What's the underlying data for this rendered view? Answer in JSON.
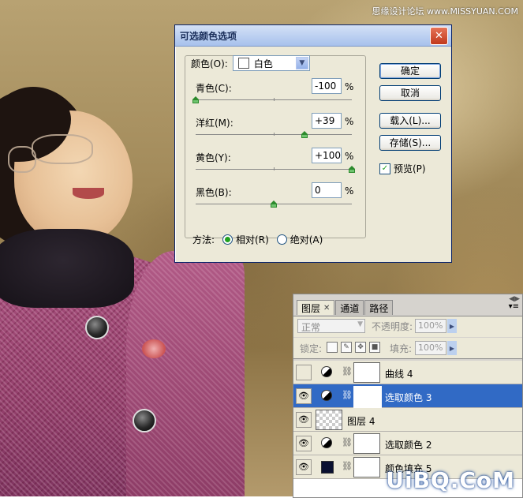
{
  "watermark_top": "思缘设计论坛 www.MISSYUAN.COM",
  "watermark_bottom": "UiBQ.CoM",
  "dialog": {
    "title": "可选颜色选项",
    "close_glyph": "✕",
    "colors_label": "颜色(O):",
    "colors_value": "白色",
    "sliders": [
      {
        "label": "青色(C):",
        "value": "-100",
        "unit": "%",
        "level": -100
      },
      {
        "label": "洋红(M):",
        "value": "+39",
        "unit": "%",
        "level": 39
      },
      {
        "label": "黄色(Y):",
        "value": "+100",
        "unit": "%",
        "level": 100
      },
      {
        "label": "黑色(B):",
        "value": "0",
        "unit": "%",
        "level": 0
      }
    ],
    "method_label": "方法:",
    "method_relative": "相对(R)",
    "method_absolute": "绝对(A)",
    "method_selected": "relative",
    "buttons": {
      "ok": "确定",
      "cancel": "取消",
      "load": "载入(L)...",
      "save": "存储(S)..."
    },
    "preview_label": "预览(P)",
    "preview_checked": true
  },
  "layers_panel": {
    "tabs": [
      {
        "label": "图层",
        "active": true,
        "closable": true
      },
      {
        "label": "通道",
        "active": false,
        "closable": false
      },
      {
        "label": "路径",
        "active": false,
        "closable": false
      }
    ],
    "blend_mode": "正常",
    "opacity_label": "不透明度:",
    "opacity_value": "100%",
    "lock_label": "锁定:",
    "fill_label": "填充:",
    "fill_value": "100%",
    "layers": [
      {
        "name": "曲线 4",
        "visible": false,
        "type": "adjustment",
        "selected": false
      },
      {
        "name": "选取颜色 3",
        "visible": true,
        "type": "adjustment",
        "selected": true
      },
      {
        "name": "图层 4",
        "visible": true,
        "type": "pixel",
        "selected": false
      },
      {
        "name": "选取颜色 2",
        "visible": true,
        "type": "adjustment",
        "selected": false
      },
      {
        "name": "颜色填充 5",
        "visible": true,
        "type": "fill",
        "selected": false
      }
    ]
  }
}
